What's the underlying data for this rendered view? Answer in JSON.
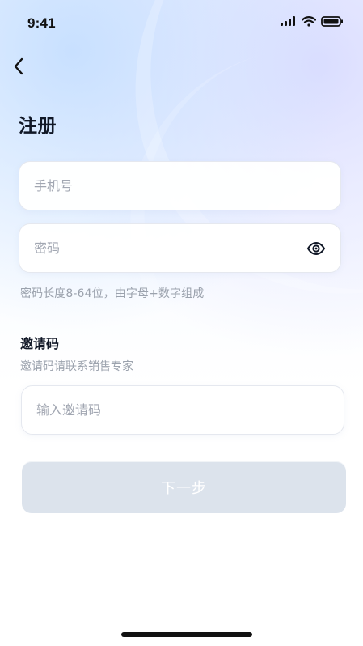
{
  "status_bar": {
    "time": "9:41"
  },
  "header": {
    "back_icon": "chevron-left-icon",
    "title": "注册"
  },
  "form": {
    "phone": {
      "placeholder": "手机号",
      "value": ""
    },
    "password": {
      "placeholder": "密码",
      "value": "",
      "toggle_icon": "eye-icon"
    },
    "password_hint": "密码长度8-64位，由字母+数字组成",
    "invite": {
      "title": "邀请码",
      "subtitle": "邀请码请联系销售专家",
      "placeholder": "输入邀请码",
      "value": ""
    }
  },
  "actions": {
    "next_label": "下一步"
  },
  "colors": {
    "primary_text": "#111827",
    "placeholder_text": "#a2a7b2",
    "hint_text": "#9ba2ad",
    "disabled_button": "#dce3ec",
    "input_border": "#e5e8ef"
  }
}
